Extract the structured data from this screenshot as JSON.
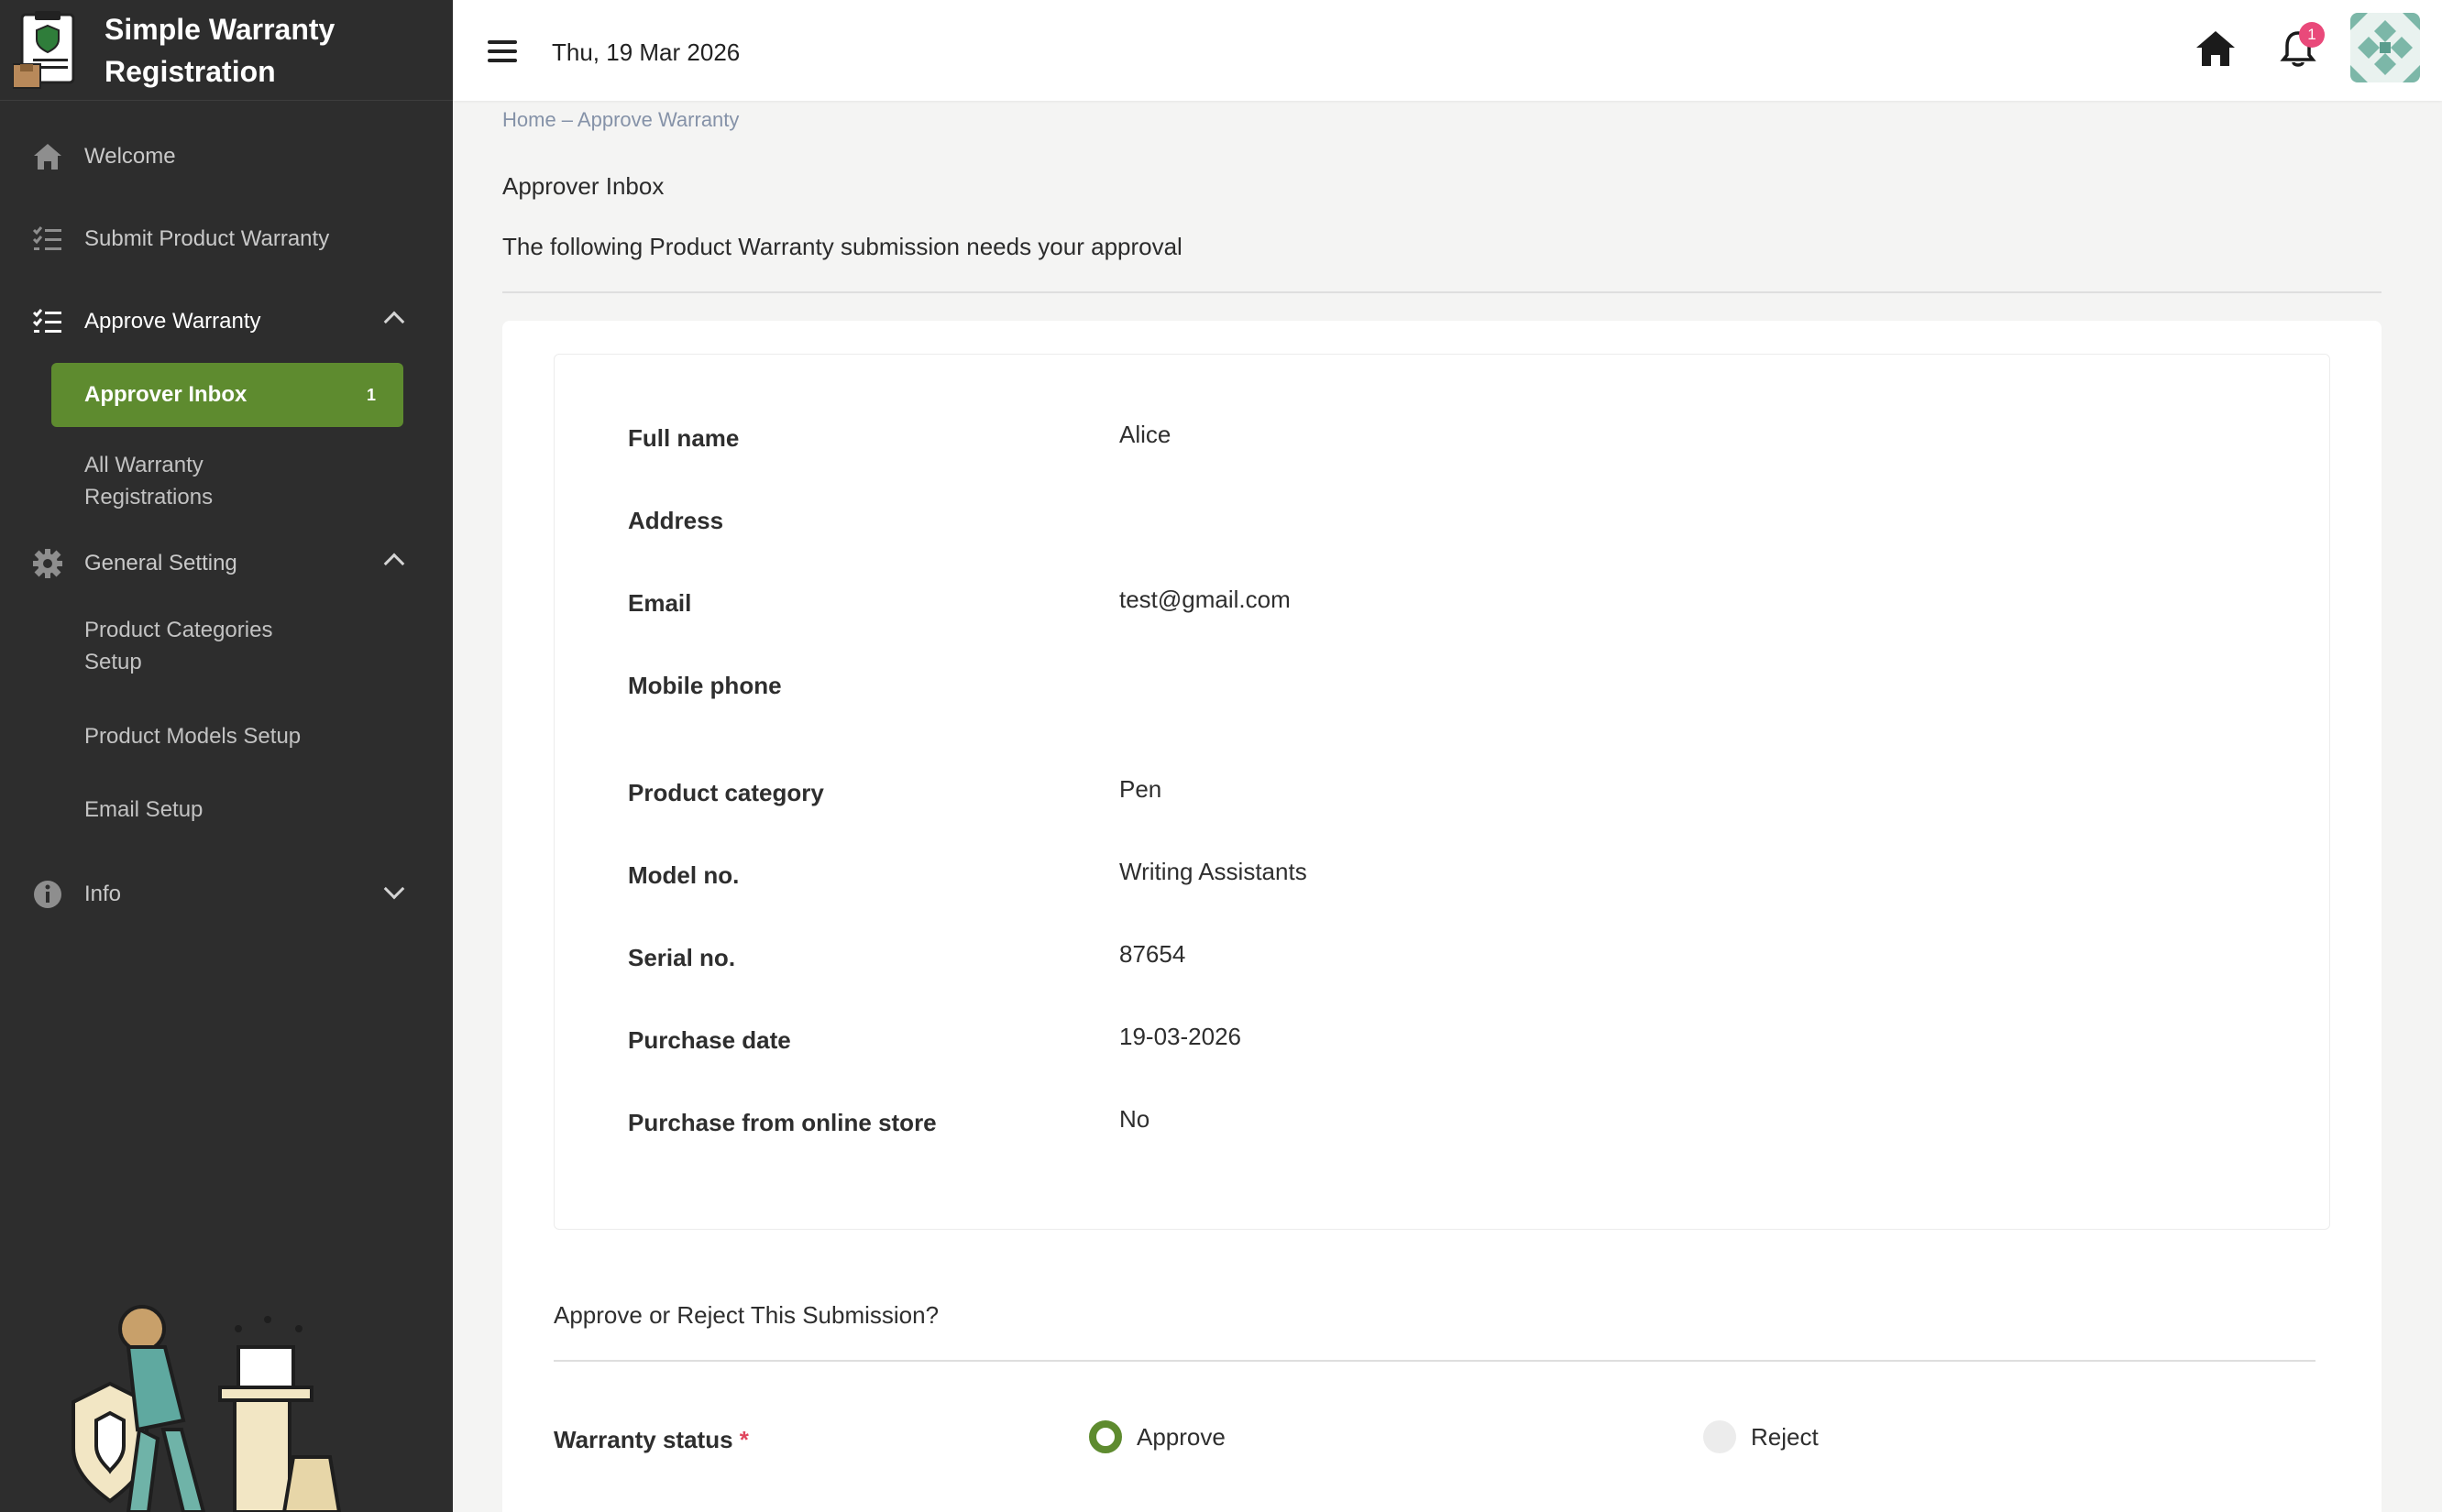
{
  "app": {
    "title": "Simple Warranty Registration",
    "title_line1": "Simple Warranty",
    "title_line2": "Registration"
  },
  "sidebar": {
    "items": [
      {
        "label": "Welcome",
        "icon": "home-icon"
      },
      {
        "label": "Submit Product Warranty",
        "icon": "checklist-icon"
      },
      {
        "label": "Approve Warranty",
        "icon": "checklist-icon",
        "expanded": true
      },
      {
        "label": "General Setting",
        "icon": "gear-icon",
        "expanded": true
      },
      {
        "label": "Info",
        "icon": "info-icon",
        "expanded": false
      }
    ],
    "approve_sub": {
      "active_label": "Approver Inbox",
      "active_badge": "1",
      "all_line1": "All Warranty",
      "all_line2": "Registrations"
    },
    "setting_sub": {
      "categories_line1": "Product Categories",
      "categories_line2": "Setup",
      "models": "Product Models Setup",
      "email": "Email Setup"
    }
  },
  "header": {
    "date": "Thu, 19 Mar 2026",
    "notification_count": "1"
  },
  "breadcrumb": "Home – Approve Warranty",
  "page": {
    "title": "Approver Inbox",
    "subtitle": "The following Product Warranty submission needs your approval"
  },
  "details": [
    {
      "label": "Full name",
      "value": "Alice"
    },
    {
      "label": "Address",
      "value": ""
    },
    {
      "label": "Email",
      "value": "test@gmail.com"
    },
    {
      "label": "Mobile phone",
      "value": ""
    },
    {
      "label": "Product category",
      "value": "Pen"
    },
    {
      "label": "Model no.",
      "value": "Writing Assistants"
    },
    {
      "label": "Serial no.",
      "value": "87654"
    },
    {
      "label": "Purchase date",
      "value": "19-03-2026"
    },
    {
      "label": "Purchase from online store",
      "value": "No"
    }
  ],
  "decision": {
    "title": "Approve or Reject This Submission?",
    "status_label": "Warranty status",
    "required_mark": "*",
    "options": [
      {
        "label": "Approve",
        "selected": true
      },
      {
        "label": "Reject",
        "selected": false
      }
    ]
  },
  "colors": {
    "accent": "#5e8b2f",
    "sidebar_bg": "#2d2d2d",
    "badge": "#e9497a"
  }
}
